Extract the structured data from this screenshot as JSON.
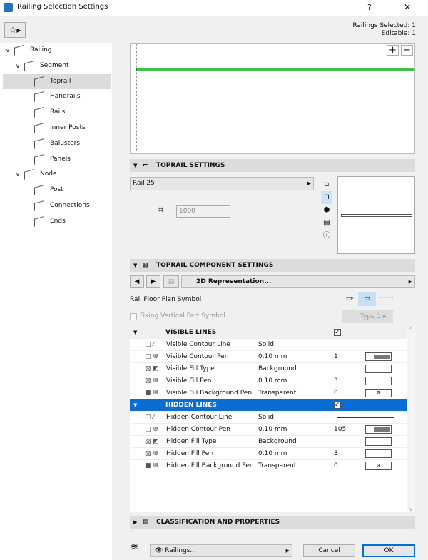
{
  "window": {
    "title": "Railing Selection Settings",
    "help": "?",
    "close": "✕"
  },
  "header": {
    "selected": "Railings Selected: 1",
    "editable": "Editable: 1"
  },
  "tree": [
    {
      "label": "Railing",
      "level": 0,
      "expand": "∨"
    },
    {
      "label": "Segment",
      "level": 1,
      "expand": "∨"
    },
    {
      "label": "Toprail",
      "level": 2,
      "selected": true
    },
    {
      "label": "Handrails",
      "level": 2
    },
    {
      "label": "Rails",
      "level": 2
    },
    {
      "label": "Inner Posts",
      "level": 2
    },
    {
      "label": "Balusters",
      "level": 2
    },
    {
      "label": "Panels",
      "level": 2
    },
    {
      "label": "Node",
      "level": 1,
      "expand": "∨"
    },
    {
      "label": "Post",
      "level": 2
    },
    {
      "label": "Connections",
      "level": 2
    },
    {
      "label": "Ends",
      "level": 2
    }
  ],
  "preview": {
    "zoom_in": "+",
    "zoom_out": "−",
    "rail_color": "#3fbf4f"
  },
  "toprail": {
    "header": "TOPRAIL SETTINGS",
    "profile": "Rail 25",
    "offset": "1000"
  },
  "component": {
    "header": "TOPRAIL COMPONENT SETTINGS",
    "view": "2D Representation...",
    "floor_plan_label": "Rail Floor Plan Symbol",
    "fixing_label": "Fixing Vertical Part Symbol",
    "type_btn": "Type 1"
  },
  "groups": [
    {
      "title": "VISIBLE LINES",
      "rows": [
        {
          "name": "Visible Contour Line",
          "value": "Solid",
          "num": "",
          "swatch": "line"
        },
        {
          "name": "Visible Contour Pen",
          "value": "0.10 mm",
          "num": "1",
          "swatch": "pen"
        },
        {
          "name": "Visible Fill Type",
          "value": "Background",
          "num": "",
          "swatch": "empty"
        },
        {
          "name": "Visible Fill Pen",
          "value": "0.10 mm",
          "num": "3",
          "swatch": "empty"
        },
        {
          "name": "Visible Fill Background Pen",
          "value": "Transparent",
          "num": "0",
          "swatch": "ø"
        }
      ]
    },
    {
      "title": "HIDDEN LINES",
      "rows": [
        {
          "name": "Hidden Contour Line",
          "value": "Solid",
          "num": "",
          "swatch": "line"
        },
        {
          "name": "Hidden Contour Pen",
          "value": "0.10 mm",
          "num": "105",
          "swatch": "pen"
        },
        {
          "name": "Hidden Fill Type",
          "value": "Background",
          "num": "",
          "swatch": "empty"
        },
        {
          "name": "Hidden Fill Pen",
          "value": "0.10 mm",
          "num": "3",
          "swatch": "empty"
        },
        {
          "name": "Hidden Fill Background Pen",
          "value": "Transparent",
          "num": "0",
          "swatch": "ø"
        }
      ]
    }
  ],
  "classification": {
    "header": "CLASSIFICATION AND PROPERTIES"
  },
  "footer": {
    "railings": "Railings..",
    "cancel": "Cancel",
    "ok": "OK"
  }
}
